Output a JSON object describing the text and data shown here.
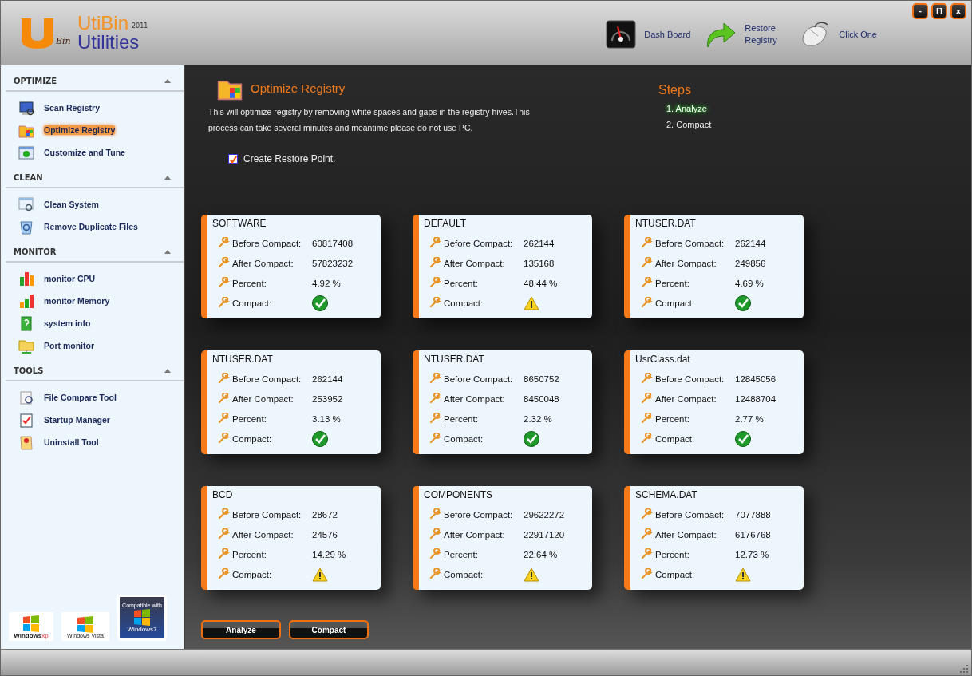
{
  "app": {
    "logo_mark": "Bin",
    "name": "UtiBin",
    "year": "2011",
    "subtitle": "Utilities"
  },
  "toolbar": [
    {
      "kind": "dashboard",
      "label": "Dash Board"
    },
    {
      "kind": "restore",
      "label": "Restore Registry"
    },
    {
      "kind": "mouse",
      "label": "Click One"
    }
  ],
  "window_controls": [
    "-",
    "[]",
    "x"
  ],
  "sidebar": {
    "sections": [
      {
        "title": "OPTIMIZE",
        "expanded": true,
        "items": [
          {
            "label": "Scan Registry",
            "selected": false
          },
          {
            "label": "Optimize Registry",
            "selected": true
          },
          {
            "label": "Customize and Tune",
            "selected": false
          }
        ]
      },
      {
        "title": "CLEAN",
        "expanded": true,
        "items": [
          {
            "label": "Clean System",
            "selected": false
          },
          {
            "label": "Remove Duplicate Files",
            "selected": false
          }
        ]
      },
      {
        "title": "MONITOR",
        "expanded": true,
        "items": [
          {
            "label": "monitor CPU",
            "selected": false
          },
          {
            "label": "monitor Memory",
            "selected": false
          },
          {
            "label": "system info",
            "selected": false
          },
          {
            "label": "Port monitor",
            "selected": false
          }
        ]
      },
      {
        "title": "TOOLS",
        "expanded": true,
        "items": [
          {
            "label": "File Compare Tool",
            "selected": false
          },
          {
            "label": "Startup Manager",
            "selected": false
          },
          {
            "label": "Uninstall Tool",
            "selected": false
          }
        ]
      }
    ],
    "badges": [
      {
        "kind": "xp",
        "text": "Windows",
        "suffix": "xp"
      },
      {
        "kind": "vista",
        "text": "Windows Vista"
      },
      {
        "kind": "seven",
        "caption": "Compatible with",
        "text": "Windows7"
      }
    ]
  },
  "page": {
    "title": "Optimize Registry",
    "description": "This will optimize registry by removing white spaces and gaps in the registry hives.This process can take several minutes and meantime please do not use PC.",
    "restore_point": {
      "label": "Create Restore Point.",
      "checked": true
    },
    "steps_title": "Steps",
    "steps": [
      {
        "label": "1. Analyze",
        "selected": true
      },
      {
        "label": "2. Compact",
        "selected": false
      }
    ]
  },
  "hives": [
    {
      "name": "SOFTWARE",
      "rows": [
        {
          "label": "Before Compact:",
          "value": "60817408"
        },
        {
          "label": "After Compact:",
          "value": "57823232"
        },
        {
          "label": "Percent:",
          "value": "4.92 %"
        },
        {
          "label": "Compact:",
          "ok": true
        }
      ]
    },
    {
      "name": "DEFAULT",
      "rows": [
        {
          "label": "Before Compact:",
          "value": "262144"
        },
        {
          "label": "After Compact:",
          "value": "135168"
        },
        {
          "label": "Percent:",
          "value": "48.44 %"
        },
        {
          "label": "Compact:",
          "ok": false
        }
      ]
    },
    {
      "name": "NTUSER.DAT",
      "rows": [
        {
          "label": "Before Compact:",
          "value": "262144"
        },
        {
          "label": "After Compact:",
          "value": "249856"
        },
        {
          "label": "Percent:",
          "value": "4.69 %"
        },
        {
          "label": "Compact:",
          "ok": true
        }
      ]
    },
    {
      "name": "NTUSER.DAT",
      "rows": [
        {
          "label": "Before Compact:",
          "value": "262144"
        },
        {
          "label": "After Compact:",
          "value": "253952"
        },
        {
          "label": "Percent:",
          "value": "3.13 %"
        },
        {
          "label": "Compact:",
          "ok": true
        }
      ]
    },
    {
      "name": "NTUSER.DAT",
      "rows": [
        {
          "label": "Before Compact:",
          "value": "8650752"
        },
        {
          "label": "After Compact:",
          "value": "8450048"
        },
        {
          "label": "Percent:",
          "value": "2.32 %"
        },
        {
          "label": "Compact:",
          "ok": true
        }
      ]
    },
    {
      "name": "UsrClass.dat",
      "rows": [
        {
          "label": "Before Compact:",
          "value": "12845056"
        },
        {
          "label": "After Compact:",
          "value": "12488704"
        },
        {
          "label": "Percent:",
          "value": "2.77 %"
        },
        {
          "label": "Compact:",
          "ok": true
        }
      ]
    },
    {
      "name": "BCD",
      "rows": [
        {
          "label": "Before Compact:",
          "value": "28672"
        },
        {
          "label": "After Compact:",
          "value": "24576"
        },
        {
          "label": "Percent:",
          "value": "14.29 %"
        },
        {
          "label": "Compact:",
          "ok": false
        }
      ]
    },
    {
      "name": "COMPONENTS",
      "rows": [
        {
          "label": "Before Compact:",
          "value": "29622272"
        },
        {
          "label": "After Compact:",
          "value": "22917120"
        },
        {
          "label": "Percent:",
          "value": "22.64 %"
        },
        {
          "label": "Compact:",
          "ok": false
        }
      ]
    },
    {
      "name": "SCHEMA.DAT",
      "rows": [
        {
          "label": "Before Compact:",
          "value": "7077888"
        },
        {
          "label": "After Compact:",
          "value": "6176768"
        },
        {
          "label": "Percent:",
          "value": "12.73 %"
        },
        {
          "label": "Compact:",
          "ok": false
        }
      ]
    }
  ],
  "buttons": [
    "Analyze",
    "Compact"
  ]
}
